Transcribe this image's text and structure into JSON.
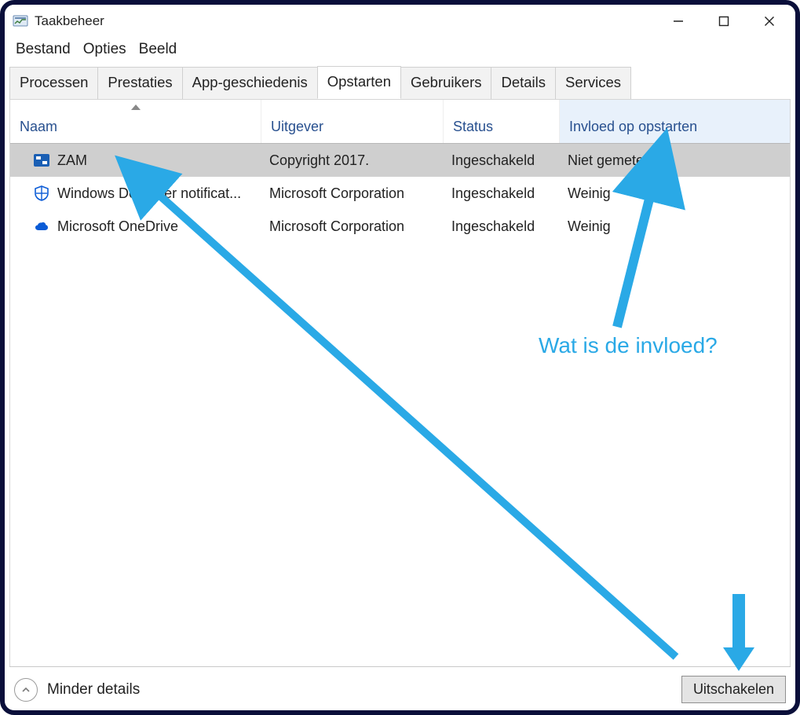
{
  "window": {
    "title": "Taakbeheer"
  },
  "menubar": {
    "items": [
      "Bestand",
      "Opties",
      "Beeld"
    ]
  },
  "tabs": {
    "items": [
      "Processen",
      "Prestaties",
      "App-geschiedenis",
      "Opstarten",
      "Gebruikers",
      "Details",
      "Services"
    ],
    "active_index": 3
  },
  "columns": {
    "naam": "Naam",
    "uitgever": "Uitgever",
    "status": "Status",
    "invloed": "Invloed op opstarten",
    "sorted_column": "naam",
    "sort_direction": "asc"
  },
  "rows": [
    {
      "selected": true,
      "icon": "zam-icon",
      "naam": "ZAM",
      "uitgever": "Copyright 2017.",
      "status": "Ingeschakeld",
      "invloed": "Niet gemeten"
    },
    {
      "selected": false,
      "icon": "defender-icon",
      "naam": "Windows Defender notificat...",
      "uitgever": "Microsoft Corporation",
      "status": "Ingeschakeld",
      "invloed": "Weinig"
    },
    {
      "selected": false,
      "icon": "onedrive-icon",
      "naam": "Microsoft OneDrive",
      "uitgever": "Microsoft Corporation",
      "status": "Ingeschakeld",
      "invloed": "Weinig"
    }
  ],
  "footer": {
    "details_label": "Minder details",
    "disable_button": "Uitschakelen"
  },
  "annotations": {
    "influence_question": "Wat is de invloed?"
  },
  "colors": {
    "accent": "#2aa9e6",
    "header_link": "#28508f"
  }
}
